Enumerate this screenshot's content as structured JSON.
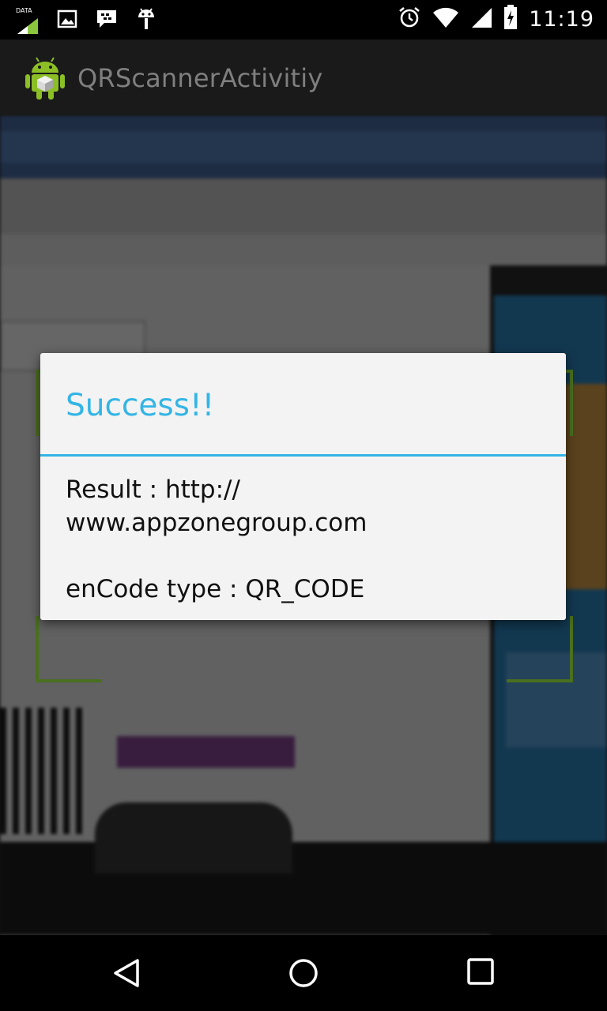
{
  "status_bar": {
    "data_label": "DATA",
    "time": "11:19",
    "icons": [
      "mobile-data-icon",
      "image-notification-icon",
      "bbm-icon",
      "android-debug-icon",
      "alarm-icon",
      "wifi-icon",
      "signal-icon",
      "battery-charging-icon"
    ]
  },
  "action_bar": {
    "title": "QRScannerActivitiy",
    "icon": "android-app-icon"
  },
  "dialog": {
    "title": "Success!!",
    "accent_color": "#33b5e5",
    "message": "Result : http://\nwww.appzonegroup.com\n\nenCode type : QR_CODE"
  },
  "nav_bar": {
    "icons": [
      "back-icon",
      "home-icon",
      "recents-icon"
    ]
  }
}
